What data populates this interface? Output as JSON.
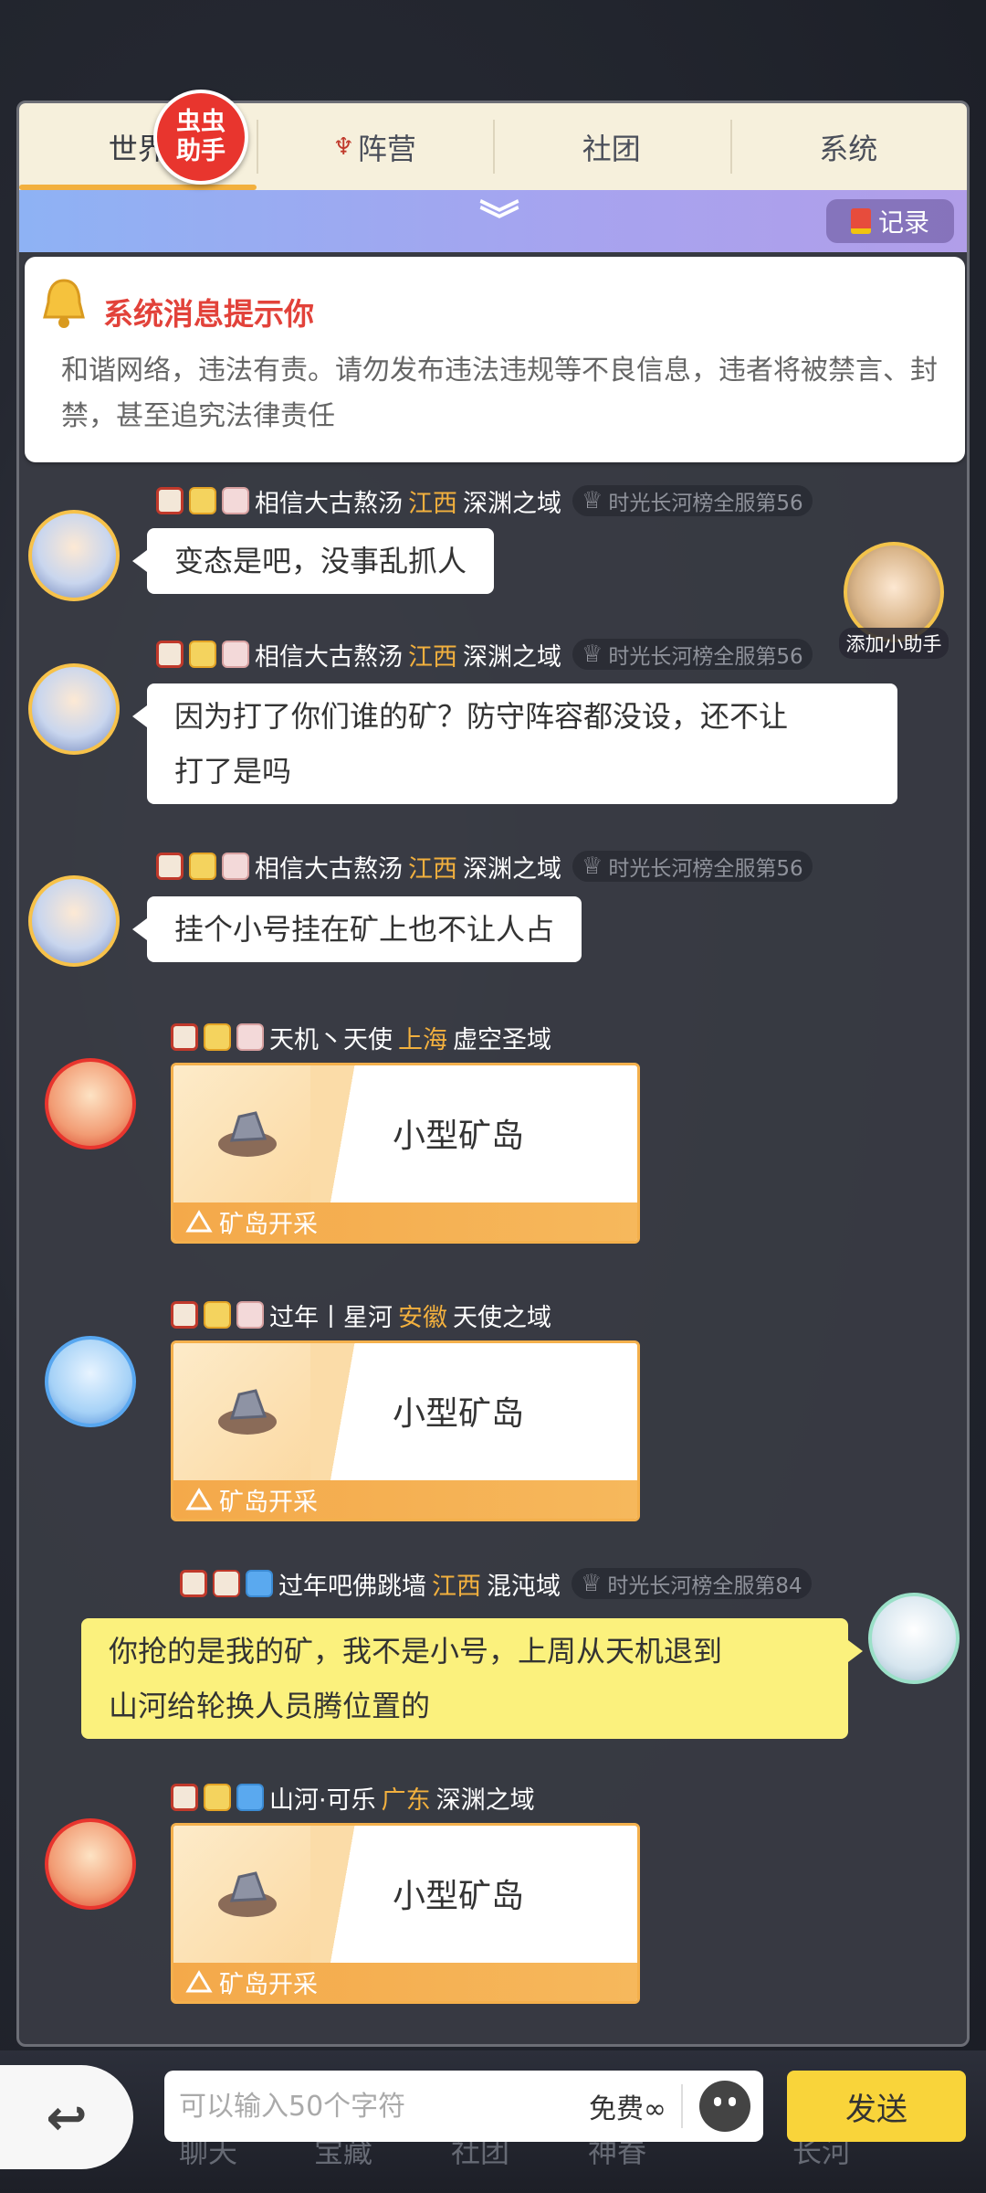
{
  "tabs": [
    {
      "label": "世界"
    },
    {
      "label": "阵营"
    },
    {
      "label": "社团"
    },
    {
      "label": "系统"
    }
  ],
  "badge": {
    "line1": "虫虫",
    "line2": "助手"
  },
  "record_label": "记录",
  "system_notice": {
    "title": "系统消息提示你",
    "text": "和谐网络，违法有责。请勿发布违法违规等不良信息，违者将被禁言、封禁，甚至追究法律责任"
  },
  "helper_label": "添加小助手",
  "messages": [
    {
      "name": "相信大古熬汤",
      "region": "江西",
      "server": "深渊之域",
      "rank": "时光长河榜全服第56",
      "text": "变态是吧，没事乱抓人"
    },
    {
      "name": "相信大古熬汤",
      "region": "江西",
      "server": "深渊之域",
      "rank": "时光长河榜全服第56",
      "text_line1": "因为打了你们谁的矿？防守阵容都没设，还不让",
      "text_line2": "打了是吗"
    },
    {
      "name": "相信大古熬汤",
      "region": "江西",
      "server": "深渊之域",
      "rank": "时光长河榜全服第56",
      "text": "挂个小号挂在矿上也不让人占"
    },
    {
      "name": "天机丶天使",
      "region": "上海",
      "server": "虚空圣域",
      "card_title": "小型矿岛",
      "card_footer": "矿岛开采"
    },
    {
      "name": "过年丨星河",
      "region": "安徽",
      "server": "天使之域",
      "card_title": "小型矿岛",
      "card_footer": "矿岛开采"
    },
    {
      "name": "过年吧佛跳墙",
      "region": "江西",
      "server": "混沌域",
      "rank": "时光长河榜全服第84",
      "text_line1": "你抢的是我的矿，我不是小号，上周从天机退到",
      "text_line2": "山河给轮换人员腾位置的"
    },
    {
      "name": "山河·可乐",
      "region": "广东",
      "server": "深渊之域",
      "card_title": "小型矿岛",
      "card_footer": "矿岛开采"
    }
  ],
  "input": {
    "placeholder": "可以输入50个字符",
    "free_label": "免费∞"
  },
  "send_label": "发送",
  "bottom_tabs": [
    "聊天",
    "宝藏",
    "社团",
    "神眷",
    "长河"
  ],
  "colors": {
    "accent": "#f2b03e",
    "notice_title": "#e2423a",
    "send": "#f9d43a",
    "my_bubble": "#fbf17d"
  }
}
